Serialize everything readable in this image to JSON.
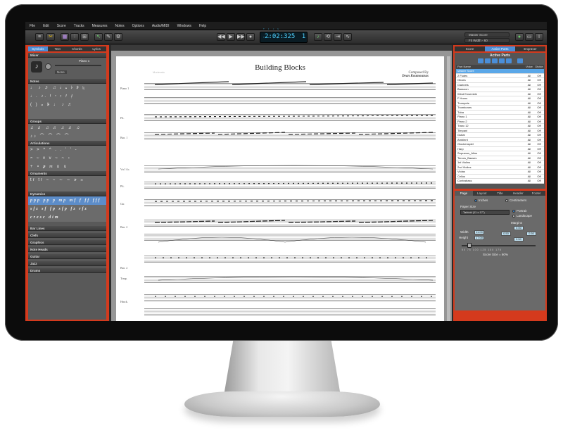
{
  "menubar": [
    "File",
    "Edit",
    "Score",
    "Tracks",
    "Measures",
    "Notes",
    "Options",
    "Audio/MIDI",
    "Windows",
    "Help"
  ],
  "transport": {
    "time": "2:02:325",
    "beat": "1",
    "labels": "Bar Beat Tick Tempo"
  },
  "toolbar": {
    "score_select": "Master Score",
    "zoom_select": "Fit Width - 60"
  },
  "left_tabs": [
    "Symbols",
    "Text",
    "Chords",
    "Lyrics"
  ],
  "mixer": {
    "header": "Mixer",
    "track": "Piano 1",
    "preset": "None"
  },
  "palettes": [
    {
      "name": "Notes",
      "symbols": [
        "♩ ♪ ♬ ♫ 𝅗𝅥 𝅝 ♭ ♯ ♮",
        "♩. ♪. 𝄽 𝄾 𝄿 𝅀 𝅁",
        "( ) 𝄪 𝄫 ♩ ♪ ♬"
      ]
    },
    {
      "name": "Groups",
      "symbols": [
        "♫ ♬ ♫ ♬ ♫ ♬ ♫",
        "♪♪ ⌒ ⌒ ⌒ ⌒"
      ]
    },
    {
      "name": "Articulations",
      "symbols": [
        "> > ^ ^ . . ' ' -",
        "𝄐 𝄑 v v ~ ~ ∘",
        "+ ∘ 𝆏 𝆐 ∪ ∪"
      ]
    },
    {
      "name": "Ornaments",
      "symbols": [
        "tr tr ~ ~ ∼ ∼ 𝆖 𝆗"
      ]
    },
    {
      "name": "Dynamics",
      "symbols": [
        "ppp pp p mp mf f ff fff",
        "sfz sf fp sfp fz rfz",
        "cresc dim"
      ]
    }
  ],
  "collapsed_sections": [
    "Bar Lines",
    "Clefs",
    "Graphics",
    "Note Heads",
    "Guitar",
    "Jazz",
    "Drums"
  ],
  "score": {
    "title": "Building Blocks",
    "composer_label": "Composed By",
    "composer": "Dean Koumoutsas",
    "tempo_hint": "Moderato"
  },
  "staves": [
    "Piano 1",
    "Flt.",
    "Bsn. 1",
    "Vn I Ac.",
    "Pft.",
    "Gtr.",
    "Bsn. 2",
    "Bsn. 2",
    "Trmp.",
    "Hmck."
  ],
  "right_tabs": [
    "Score",
    "Active Parts",
    "Engraver"
  ],
  "active_parts": {
    "header": "Active Parts",
    "columns": [
      "Part Name",
      "Voice",
      "Divide"
    ],
    "rows": [
      [
        "Master Score",
        "",
        ""
      ],
      [
        "2 Flutes",
        "All",
        "Off"
      ],
      [
        "Oboes",
        "All",
        "Off"
      ],
      [
        "Clarinets",
        "All",
        "Off"
      ],
      [
        "Bassoon",
        "All",
        "Off"
      ],
      [
        "Wind Ensemble",
        "All",
        "Off"
      ],
      [
        "F Horns",
        "All",
        "Off"
      ],
      [
        "Trumpets",
        "All",
        "Off"
      ],
      [
        "Trombones",
        "All",
        "Off"
      ],
      [
        "Tuba",
        "All",
        "Off"
      ],
      [
        "Piano 1",
        "All",
        "Off"
      ],
      [
        "Piano 2",
        "All",
        "Off"
      ],
      [
        "Tranc 12",
        "All",
        "Off"
      ],
      [
        "Timpani",
        "All",
        "Off"
      ],
      [
        "Guitar",
        "All",
        "Off"
      ],
      [
        "Ambient",
        "All",
        "Off"
      ],
      [
        "Glockenspiel",
        "All",
        "Off"
      ],
      [
        "Harp",
        "All",
        "Off"
      ],
      [
        "Sopranos_Altos",
        "All",
        "Off"
      ],
      [
        "Tenors_Basses",
        "All",
        "Off"
      ],
      [
        "1st Violins",
        "All",
        "Off"
      ],
      [
        "2nd Violins",
        "All",
        "Off"
      ],
      [
        "Violas",
        "All",
        "Off"
      ],
      [
        "Cellos",
        "All",
        "Off"
      ],
      [
        "Contrabass",
        "All",
        "Off"
      ]
    ]
  },
  "setup_tabs": [
    "Page",
    "Layout",
    "Title",
    "Header",
    "Footer"
  ],
  "page_setup": {
    "units_inches": "Inches",
    "units_cm": "Centimeters",
    "paper_size_label": "Paper Size",
    "paper_size": "Tabloid (11 x 17\")",
    "portrait": "Portrait",
    "landscape": "Landscape",
    "margins_label": "Margins",
    "width_label": "Width",
    "height_label": "Height",
    "width": "11.00",
    "height": "17.00",
    "margin_top": "0.50",
    "margin_left": "0.50",
    "margin_right": "0.50",
    "margin_bottom": "0.50",
    "scale_ticks": "50  75  100  125  150  175",
    "scale_label": "Score Size = 60%",
    "scale_value": 60
  }
}
